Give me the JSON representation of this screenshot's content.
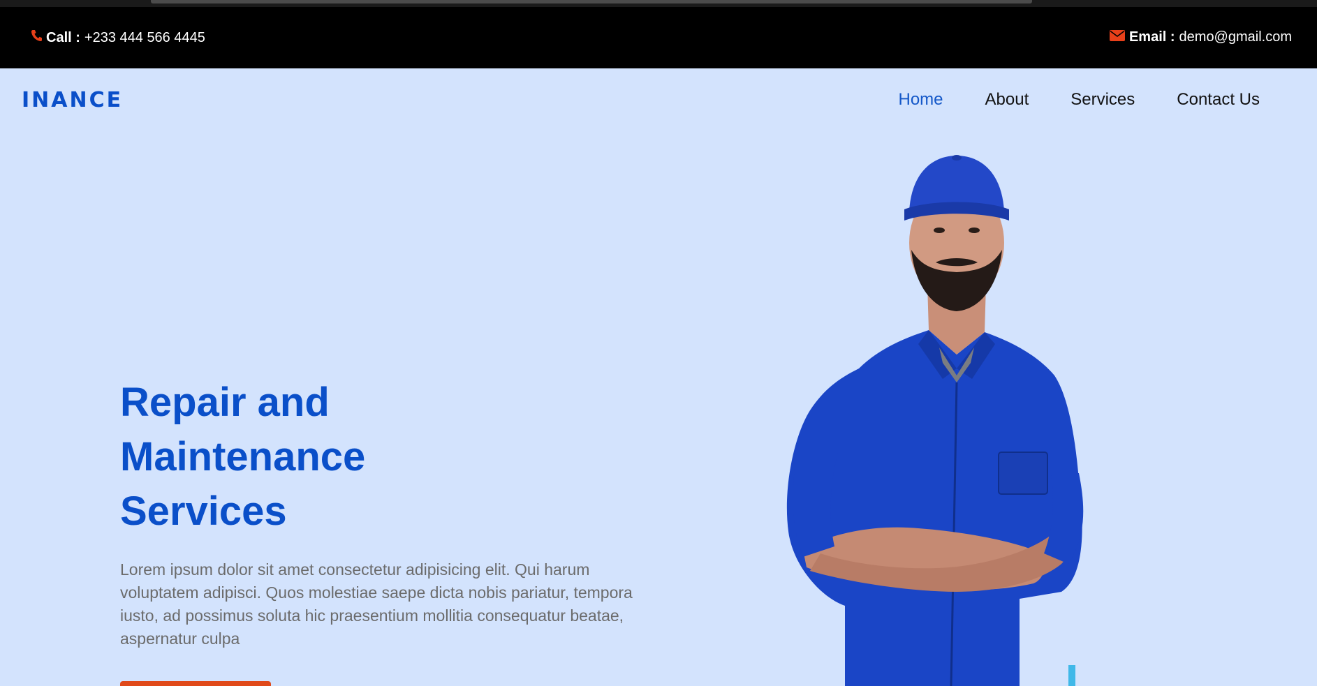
{
  "topbar": {
    "call_label": "Call :",
    "call_value": "+233 444 566 4445",
    "email_label": "Email :",
    "email_value": "demo@gmail.com",
    "icon_color": "#e8401a"
  },
  "brand": {
    "logo": "INANCE",
    "color": "#0a4fc9"
  },
  "nav": {
    "items": [
      {
        "label": "Home",
        "active": true
      },
      {
        "label": "About",
        "active": false
      },
      {
        "label": "Services",
        "active": false
      },
      {
        "label": "Contact Us",
        "active": false
      }
    ]
  },
  "hero": {
    "headline_line1": "Repair and",
    "headline_line2": "Maintenance",
    "headline_line3": "Services",
    "description": "Lorem ipsum dolor sit amet consectetur adipisicing elit. Qui harum voluptatem adipisci. Quos molestiae saepe dicta nobis pariatur, tempora iusto, ad possimus soluta hic praesentium mollitia consequatur beatae, aspernatur culpa",
    "background": "#d3e3fd",
    "cta_color": "#e0491a"
  },
  "icons": {
    "phone": "phone-icon",
    "email": "envelope-icon"
  }
}
